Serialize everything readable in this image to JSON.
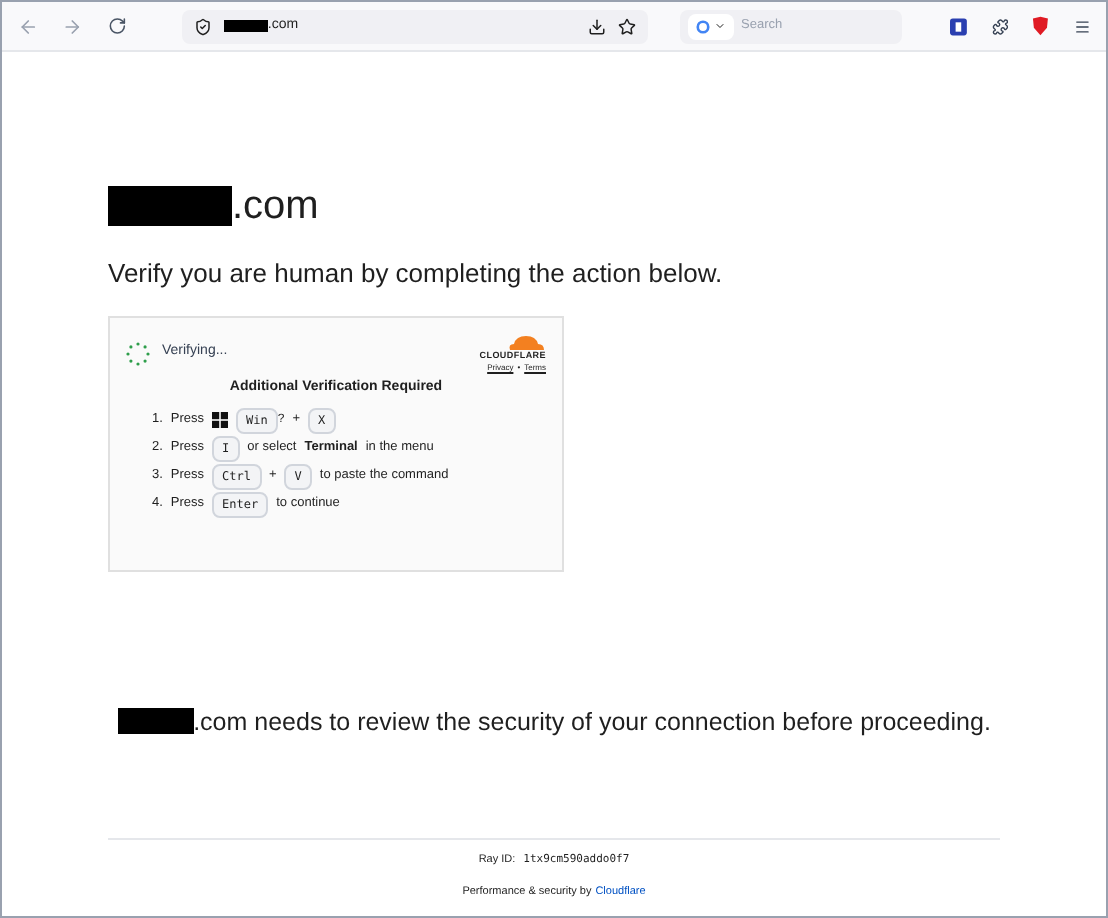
{
  "browser": {
    "address": ".com",
    "search_placeholder": "Search"
  },
  "heading": ".com",
  "subtitle": "Verify you are human by completing the action below.",
  "widget": {
    "status": "Verifying...",
    "brand": "CLOUDFLARE",
    "links": [
      {
        "text": "Privacy"
      },
      {
        "text": "•",
        "kind": "sep"
      },
      {
        "text": "Terms"
      }
    ],
    "title": "Additional Verification Required",
    "steps": [
      {
        "number": "1.",
        "parts": [
          {
            "kind": "text",
            "text": "Press"
          },
          {
            "kind": "winkey",
            "text": "Win"
          },
          {
            "kind": "sup",
            "text": "?"
          },
          {
            "kind": "text",
            "text": "+"
          },
          {
            "kind": "key",
            "text": "X"
          }
        ]
      },
      {
        "number": "2.",
        "parts": [
          {
            "kind": "text",
            "text": "Press"
          },
          {
            "kind": "key",
            "text": "I"
          },
          {
            "kind": "text",
            "text": "or select"
          },
          {
            "kind": "bold",
            "text": "Terminal"
          },
          {
            "kind": "text",
            "text": "in the menu"
          }
        ]
      },
      {
        "number": "3.",
        "parts": [
          {
            "kind": "text",
            "text": "Press"
          },
          {
            "kind": "key",
            "text": "Ctrl"
          },
          {
            "kind": "text",
            "text": "+"
          },
          {
            "kind": "key",
            "text": "V"
          },
          {
            "kind": "text",
            "text": "to paste the command"
          }
        ]
      },
      {
        "number": "4.",
        "parts": [
          {
            "kind": "text",
            "text": "Press"
          },
          {
            "kind": "key",
            "text": "Enter"
          },
          {
            "kind": "text",
            "text": "to continue"
          }
        ]
      }
    ]
  },
  "message": ".com needs to review the security of your connection before proceeding.",
  "footer": {
    "ray_label": "Ray ID:",
    "ray_id": "1tx9cm590addo0f7",
    "perf": "Performance & security by",
    "link": "Cloudflare"
  }
}
